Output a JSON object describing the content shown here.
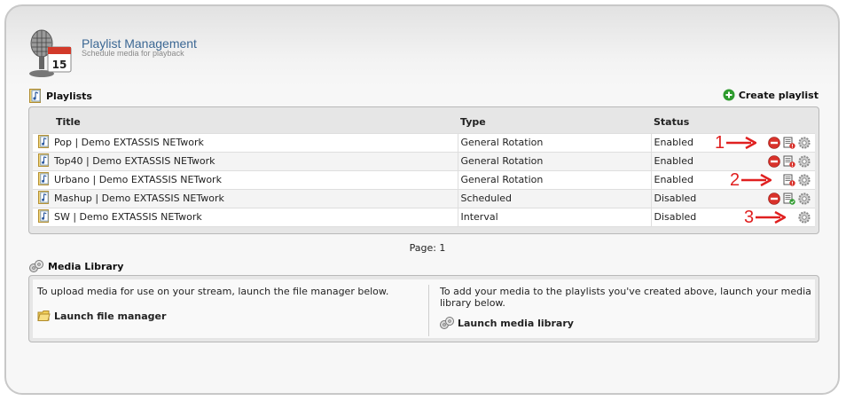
{
  "header": {
    "title": "Playlist Management",
    "subtitle": "Schedule media for playback",
    "icon": "microphone-calendar-icon",
    "calendar_day": "15"
  },
  "playlists_section": {
    "title": "Playlists",
    "create_label": "Create playlist"
  },
  "table": {
    "columns": {
      "title": "Title",
      "type": "Type",
      "status": "Status"
    },
    "rows": [
      {
        "title": "Pop | Demo EXTASSIS NETwork",
        "type": "General Rotation",
        "status": "Enabled",
        "actions": [
          "disable-icon",
          "playlist-alert-icon",
          "gear-icon"
        ]
      },
      {
        "title": "Top40 | Demo EXTASSIS NETwork",
        "type": "General Rotation",
        "status": "Enabled",
        "actions": [
          "disable-icon",
          "playlist-alert-icon",
          "gear-icon"
        ]
      },
      {
        "title": "Urbano | Demo EXTASSIS NETwork",
        "type": "General Rotation",
        "status": "Enabled",
        "actions": [
          "playlist-alert-icon",
          "gear-icon"
        ]
      },
      {
        "title": "Mashup | Demo EXTASSIS NETwork",
        "type": "Scheduled",
        "status": "Disabled",
        "actions": [
          "disable-icon",
          "playlist-enabled-icon",
          "gear-icon"
        ]
      },
      {
        "title": "SW | Demo EXTASSIS NETwork",
        "type": "Interval",
        "status": "Disabled",
        "actions": [
          "gear-icon"
        ]
      }
    ]
  },
  "annotations": {
    "one": "1",
    "two": "2",
    "three": "3",
    "color": "#e02020"
  },
  "pagination": {
    "label": "Page: 1"
  },
  "media_library": {
    "title": "Media Library",
    "left_text": "To upload media for use on your stream, launch the file manager below.",
    "left_link": "Launch file manager",
    "right_text": "To add your media to the playlists you've created above, launch your media library below.",
    "right_link": "Launch media library"
  },
  "colors": {
    "title_blue": "#3c6894",
    "disable_red": "#d9322b",
    "create_green": "#2e9b2e"
  }
}
